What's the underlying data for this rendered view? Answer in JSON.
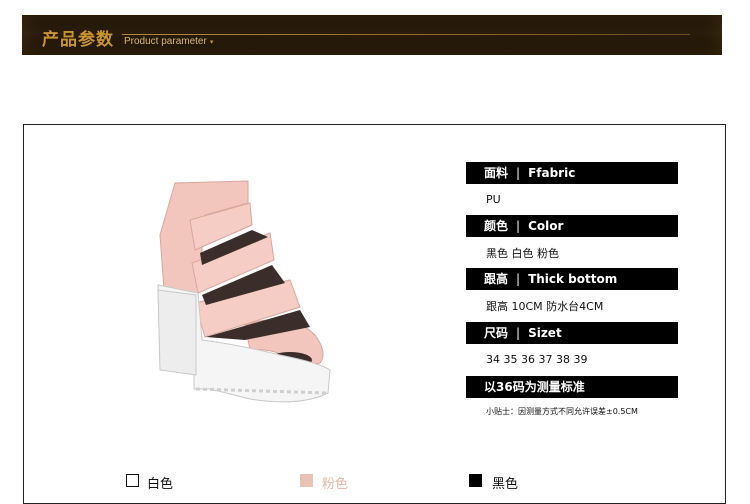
{
  "banner": {
    "title": "产品参数",
    "subtitle": "Product parameter",
    "arrow": "▾"
  },
  "specs": [
    {
      "header_cn": "面料",
      "header_en": "Ffabric",
      "value": "PU"
    },
    {
      "header_cn": "颜色",
      "header_en": "Color",
      "value": "黑色  白色  粉色"
    },
    {
      "header_cn": "跟高",
      "header_en": "Thick bottom",
      "value": "跟高  10CM     防水台4CM"
    },
    {
      "header_cn": "尺码",
      "header_en": "Sizet",
      "value": "34  35  36  37  38  39"
    },
    {
      "header_cn": "以36码为测量标准",
      "header_en": "",
      "value": ""
    }
  ],
  "separator": "|",
  "note": "小贴士：因测量方式不同允许误差±0.5CM",
  "swatches": [
    {
      "label": "白色",
      "color": "#ffffff",
      "text_color": "#111111"
    },
    {
      "label": "粉色",
      "color": "#e9c3b4",
      "text_color": "#e6b9a8"
    },
    {
      "label": "黑色",
      "color": "#000000",
      "text_color": "#111111"
    }
  ],
  "colors": {
    "banner_bg": "#1f150a",
    "banner_gold": "#c9952f",
    "shoe_pink": "#f3c6bd",
    "sole_white": "#f5f5f5"
  },
  "product_image": "pink-platform-sandal"
}
